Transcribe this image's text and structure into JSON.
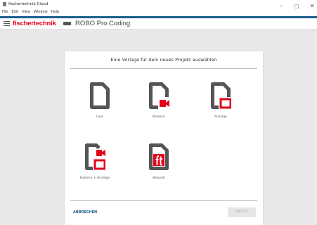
{
  "window": {
    "title": "fischertechnik Cloud",
    "menu": [
      "File",
      "Edit",
      "View",
      "Window",
      "Help"
    ]
  },
  "header": {
    "brand": "fischertechnik",
    "app_name": "ROBO Pro Coding"
  },
  "dialog": {
    "title": "Eine Vorlage für dein neues Projekt auswählen",
    "templates": [
      {
        "label": "Leer",
        "icon": "blank-document-icon"
      },
      {
        "label": "Kamera",
        "icon": "document-camera-icon"
      },
      {
        "label": "Anzeige",
        "icon": "document-display-icon"
      },
      {
        "label": "Kamera + Anzeige",
        "icon": "document-camera-display-icon"
      },
      {
        "label": "Beispiel",
        "icon": "document-ft-example-icon"
      }
    ],
    "cancel_label": "ABBRECHEN",
    "next_label": "WEITER"
  },
  "colors": {
    "accent": "#1a5f8e",
    "brand_red": "#e3001b",
    "icon_gray": "#555555"
  }
}
